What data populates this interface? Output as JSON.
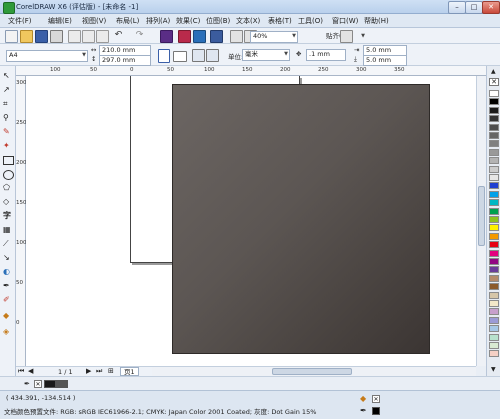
{
  "window": {
    "title": "CorelDRAW X6 (评估版) - [未命名 -1]"
  },
  "menu": [
    {
      "label": "文件(F)"
    },
    {
      "label": "编辑(E)"
    },
    {
      "label": "视图(V)"
    },
    {
      "label": "布局(L)"
    },
    {
      "label": "排列(A)"
    },
    {
      "label": "效果(C)"
    },
    {
      "label": "位图(B)"
    },
    {
      "label": "文本(X)"
    },
    {
      "label": "表格(T)"
    },
    {
      "label": "工具(O)"
    },
    {
      "label": "窗口(W)"
    },
    {
      "label": "帮助(H)"
    }
  ],
  "standard_toolbar": {
    "zoom": "40%",
    "snap": "贴齐(T)"
  },
  "property_bar": {
    "page_size": "A4",
    "width": "210.0 mm",
    "height": "297.0 mm",
    "units_label": "单位:",
    "units": "毫米",
    "nudge": ".1 mm",
    "dup_x": "5.0 mm",
    "dup_y": "5.0 mm"
  },
  "ruler_top_marks": [
    "100",
    "50",
    "0",
    "50",
    "100",
    "150",
    "200",
    "250",
    "300",
    "350"
  ],
  "ruler_left_marks": [
    "300",
    "250",
    "200",
    "150",
    "100",
    "50",
    "0"
  ],
  "page_nav": {
    "counter": "1 / 1",
    "page_tab": "页1"
  },
  "status": {
    "cursor": "( 434.391, -134.514 )",
    "color_profile": "文档颜色预置文件: RGB: sRGB IEC61966-2.1; CMYK: Japan Color 2001 Coated; 灰度: Dot Gain 15%"
  },
  "palette_colors": [
    "#ffffff",
    "#000000",
    "#1a1a1a",
    "#333333",
    "#4d4d4d",
    "#666666",
    "#808080",
    "#999999",
    "#b3b3b3",
    "#cccccc",
    "#e6e6e6",
    "#1f3fd1",
    "#00a0e9",
    "#00b7c3",
    "#00a04f",
    "#8dc21f",
    "#fff100",
    "#f39800",
    "#e60012",
    "#e4007f",
    "#920783",
    "#6a3d9a",
    "#b58b6b",
    "#8b5a2b",
    "#d6c6a8",
    "#f3e8c8",
    "#c7a0cc",
    "#9b9bd6",
    "#a6c8e6",
    "#b7e1cd",
    "#d9ead3",
    "#f5d0c5"
  ]
}
